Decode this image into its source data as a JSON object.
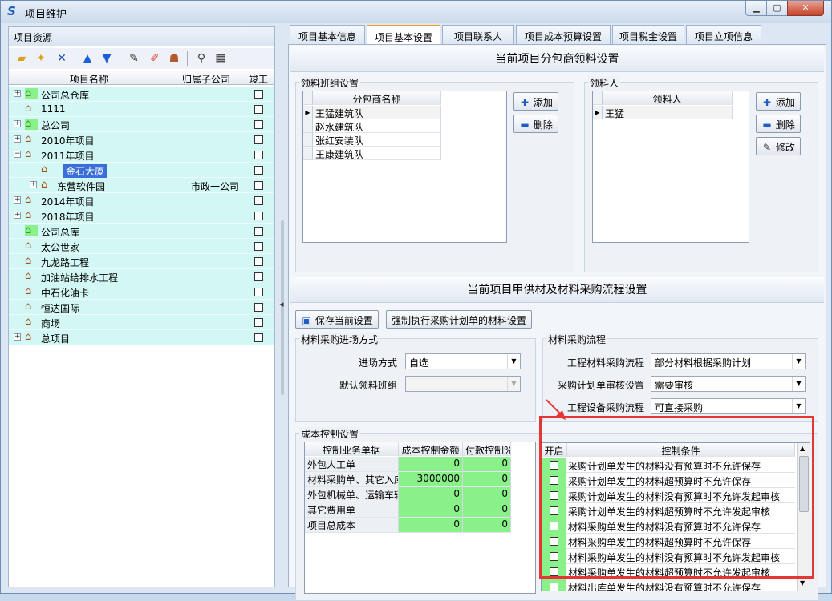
{
  "window": {
    "title": "项目维护",
    "min": "▁",
    "max": "▢",
    "close": "✕"
  },
  "left": {
    "header": "项目资源",
    "columns": {
      "name": "项目名称",
      "sub": "归属子公司",
      "done": "竣工"
    },
    "rows": [
      {
        "exp": "+",
        "icon": "warehouse-icon",
        "label": "公司总仓库",
        "sub": ""
      },
      {
        "exp": "",
        "icon": "house-icon",
        "label": "1111",
        "sub": ""
      },
      {
        "exp": "+",
        "icon": "warehouse-icon",
        "label": "总公司",
        "sub": ""
      },
      {
        "exp": "+",
        "icon": "house-icon",
        "label": "2010年项目",
        "sub": ""
      },
      {
        "exp": "−",
        "icon": "house-icon",
        "label": "2011年项目",
        "sub": ""
      },
      {
        "exp": "",
        "icon": "house-icon",
        "label": "金石大厦",
        "sub": ""
      },
      {
        "exp": "+",
        "icon": "house-icon",
        "label": "东营软件园",
        "sub": "市政一公司"
      },
      {
        "exp": "+",
        "icon": "house-icon",
        "label": "2014年项目",
        "sub": ""
      },
      {
        "exp": "+",
        "icon": "house-icon",
        "label": "2018年项目",
        "sub": ""
      },
      {
        "exp": "",
        "icon": "warehouse-icon",
        "label": "公司总库",
        "sub": ""
      },
      {
        "exp": "",
        "icon": "house-icon",
        "label": "太公世家",
        "sub": ""
      },
      {
        "exp": "",
        "icon": "house-icon",
        "label": "九龙路工程",
        "sub": ""
      },
      {
        "exp": "",
        "icon": "house-icon",
        "label": "加油站给排水工程",
        "sub": ""
      },
      {
        "exp": "",
        "icon": "house-icon",
        "label": "中石化油卡",
        "sub": ""
      },
      {
        "exp": "",
        "icon": "house-icon",
        "label": "恒达国际",
        "sub": ""
      },
      {
        "exp": "",
        "icon": "house-icon",
        "label": "商场",
        "sub": ""
      },
      {
        "exp": "+",
        "icon": "house-icon",
        "label": "总项目",
        "sub": ""
      }
    ]
  },
  "tabs": [
    "项目基本信息",
    "项目基本设置",
    "项目联系人",
    "项目成本预算设置",
    "项目税金设置",
    "项目立项信息"
  ],
  "active_tab": 1,
  "section1": {
    "title": "当前项目分包商领料设置",
    "team_group": "领料班组设置",
    "team_col": "分包商名称",
    "teams": [
      "王猛建筑队",
      "赵水建筑队",
      "张红安装队",
      "王康建筑队"
    ],
    "person_group": "领料人",
    "person_col": "领料人",
    "persons": [
      "王猛"
    ],
    "add": "添加",
    "delete": "删除",
    "edit": "修改"
  },
  "section2": {
    "title": "当前项目甲供材及材料采购流程设置",
    "save_btn": "保存当前设置",
    "force_btn": "强制执行采购计划单的材料设置",
    "entry_group": "材料采购进场方式",
    "entry_mode_label": "进场方式",
    "entry_mode_value": "自选",
    "default_team_label": "默认领料班组",
    "default_team_value": "",
    "flow_group": "材料采购流程",
    "flow1_label": "工程材料采购流程",
    "flow1_value": "部分材料根据采购计划",
    "flow2_label": "采购计划单审核设置",
    "flow2_value": "需要审核",
    "flow3_label": "工程设备采购流程",
    "flow3_value": "可直接采购"
  },
  "cost": {
    "group": "成本控制设置",
    "cols": [
      "控制业务单据",
      "成本控制金额",
      "付款控制%"
    ],
    "rows": [
      [
        "外包人工单",
        "0",
        "0"
      ],
      [
        "材料采购单、其它入库单",
        "3000000",
        "0"
      ],
      [
        "外包机械单、运输车辆单",
        "0",
        "0"
      ],
      [
        "其它费用单",
        "0",
        "0"
      ],
      [
        "项目总成本",
        "0",
        "0"
      ]
    ],
    "cond_cols": [
      "开启",
      "控制条件"
    ],
    "conditions": [
      "采购计划单发生的材料没有预算时不允许保存",
      "采购计划单发生的材料超预算时不允许保存",
      "采购计划单发生的材料没有预算时不允许发起审核",
      "采购计划单发生的材料超预算时不允许发起审核",
      "材料采购单发生的材料没有预算时不允许保存",
      "材料采购单发生的材料超预算时不允许保存",
      "材料采购单发生的材料没有预算时不允许发起审核",
      "材料采购单发生的材料超预算时不允许发起审核",
      "材料出库单发生的材料没有预算时不允许保存"
    ]
  },
  "colors": {
    "row_bg": "#d2f7f4",
    "selected": "#3a6fd8",
    "green_cell": "#8af18a",
    "highlight": "#e53636",
    "tab_accent": "#f0a020"
  }
}
